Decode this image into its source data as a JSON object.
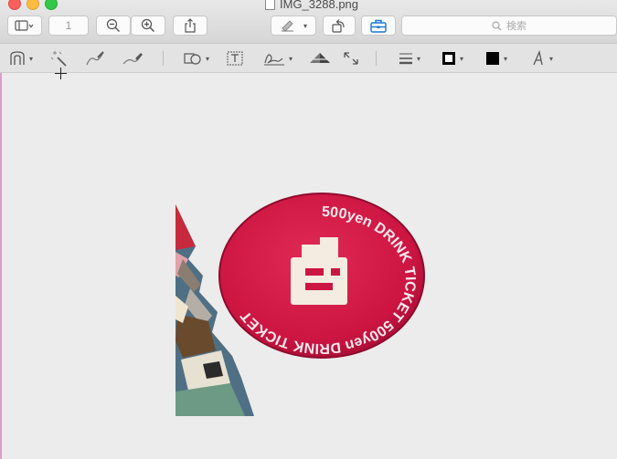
{
  "window": {
    "title": "IMG_3288.png"
  },
  "toolbar": {
    "page_number": "1",
    "search_placeholder": "検索"
  },
  "badge": {
    "ring_text": "500yen DRINK TICKET 500yen DRINK TICKET",
    "color": "#d51845"
  },
  "colors": {
    "canvas": "#ececec",
    "accent": "#1a76d2"
  }
}
